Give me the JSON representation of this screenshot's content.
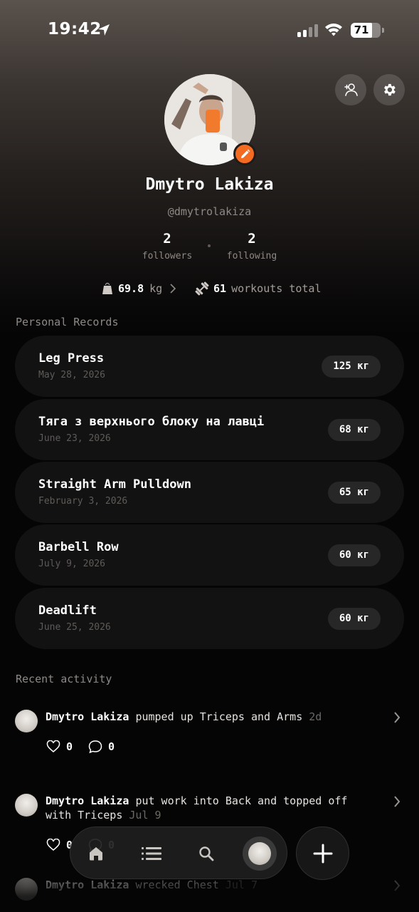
{
  "status_bar": {
    "time": "19:42",
    "battery": "71"
  },
  "profile": {
    "name": "Dmytro Lakiza",
    "handle": "@dmytrolakiza",
    "followers_count": "2",
    "followers_label": "followers",
    "following_count": "2",
    "following_label": "following",
    "weight_value": "69.8",
    "weight_unit": "kg",
    "workouts_value": "61",
    "workouts_label": "workouts total"
  },
  "personal_records": {
    "title": "Personal Records",
    "items": [
      {
        "name": "Leg Press",
        "date": "May 28, 2026",
        "value": "125 кг"
      },
      {
        "name": "Тяга з верхнього блоку на лавці",
        "date": "June 23, 2026",
        "value": "68 кг"
      },
      {
        "name": "Straight Arm Pulldown",
        "date": "February 3, 2026",
        "value": "65 кг"
      },
      {
        "name": "Barbell Row",
        "date": "July 9, 2026",
        "value": "60 кг"
      },
      {
        "name": "Deadlift",
        "date": "June 25, 2026",
        "value": "60 кг"
      }
    ]
  },
  "recent_activity": {
    "title": "Recent activity",
    "items": [
      {
        "user": "Dmytro Lakiza",
        "text": "pumped up Triceps and Arms",
        "time": "2d",
        "likes": "0",
        "comments": "0"
      },
      {
        "user": "Dmytro Lakiza",
        "text": "put work into Back and topped off with Triceps",
        "time": "Jul 9",
        "likes": "0",
        "comments": "0"
      },
      {
        "user": "Dmytro Lakiza",
        "text": "wrecked Chest",
        "time": "Jul 7"
      }
    ]
  },
  "colors": {
    "accent": "#f36b21",
    "background": "#050505",
    "card": "#121212",
    "pill": "#272727"
  },
  "icons": {
    "top_actions": [
      "add-person-icon",
      "gear-icon"
    ],
    "nav": [
      "home-icon",
      "list-icon",
      "search-icon",
      "profile-avatar"
    ],
    "fab": "plus-icon"
  }
}
